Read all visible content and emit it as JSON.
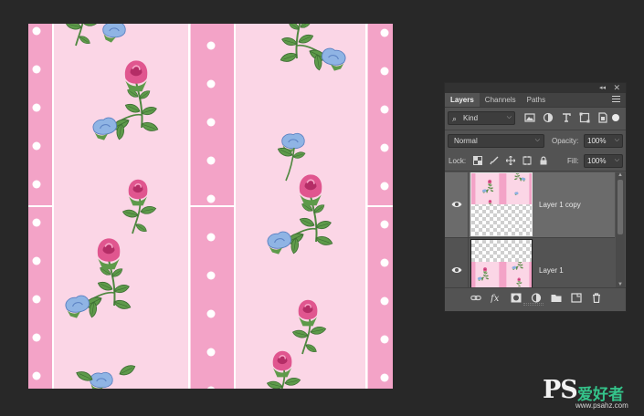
{
  "document": {
    "pattern_colors": {
      "wide_stripe": "#fbd6e6",
      "narrow_stripe": "#f3a3c7",
      "divider": "#ffffff",
      "polka_dot": "#ffffff",
      "leaf": "#5e9a4a",
      "leaf_dark": "#3d6e34",
      "rose": "#e0568f",
      "rose_dark": "#b42d66",
      "blue_flower": "#8fb4e4",
      "blue_flower_dark": "#5a80c2"
    }
  },
  "layers_panel": {
    "tabs": [
      {
        "label": "Layers",
        "active": true
      },
      {
        "label": "Channels",
        "active": false
      },
      {
        "label": "Paths",
        "active": false
      }
    ],
    "filter": {
      "kind_label": "Kind"
    },
    "blend_mode": "Normal",
    "opacity_label": "Opacity:",
    "opacity_value": "100%",
    "lock_label": "Lock:",
    "fill_label": "Fill:",
    "fill_value": "100%",
    "layers": [
      {
        "name": "Layer 1 copy",
        "selected": true,
        "visible": true
      },
      {
        "name": "Layer 1",
        "selected": false,
        "visible": true
      }
    ],
    "footer_icons": [
      "link-layers-icon",
      "fx-icon",
      "add-mask-icon",
      "adjustment-layer-icon",
      "group-folder-icon",
      "new-layer-icon",
      "trash-icon"
    ]
  },
  "watermark": {
    "logo": "PS",
    "site_name": "爱好者",
    "url": "www.psahz.com"
  }
}
